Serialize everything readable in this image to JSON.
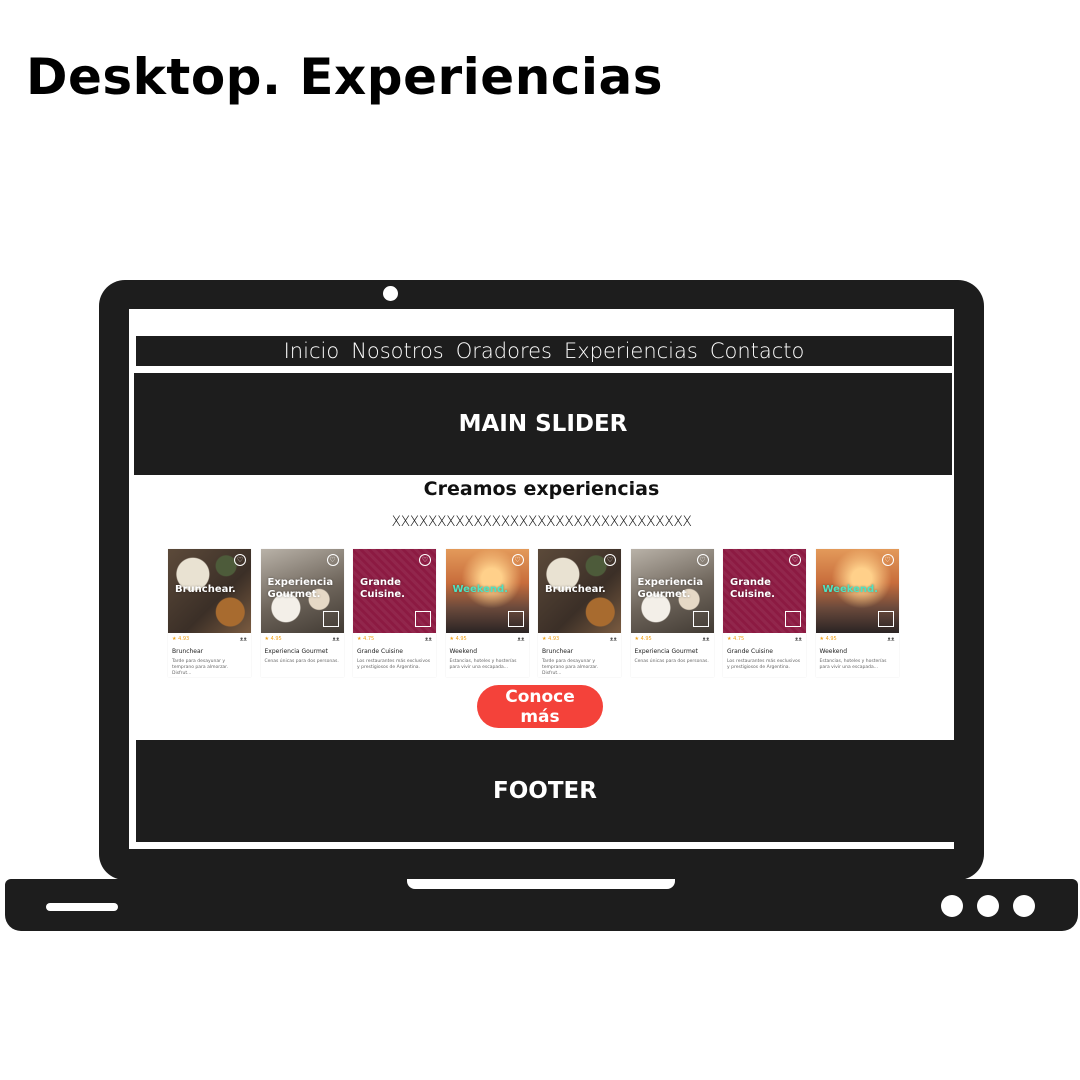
{
  "page_title": "Desktop. Experiencias",
  "nav": {
    "items": [
      "Inicio",
      "Nosotros",
      "Oradores",
      "Experiencias",
      "Contacto"
    ]
  },
  "slider": {
    "label": "MAIN SLIDER"
  },
  "section": {
    "title": "Creamos experiencias",
    "subtitle": "XXXXXXXXXXXXXXXXXXXXXXXXXXXXXXXXX"
  },
  "cards": [
    {
      "image_text": "Brunchear.",
      "rating": "★ 4.93",
      "name": "Brunchear",
      "description": "Tarde para desayunar y temprano para almorzar. Disfrut...",
      "image": "food"
    },
    {
      "image_text": "Experiencia Gourmet.",
      "rating": "★ 4.95",
      "name": "Experiencia Gourmet",
      "description": "Cenas únicas para dos personas.",
      "image": "gourmet"
    },
    {
      "image_text": "Grande Cuisine.",
      "rating": "★ 4.75",
      "name": "Grande Cuisine",
      "description": "Los restaurantes más exclusivos y prestigiosos de Argentina.",
      "image": "cuisine"
    },
    {
      "image_text": "Weekend.",
      "rating": "★ 4.95",
      "name": "Weekend",
      "description": "Estancias, hoteles y hosterías para vivir una escapada...",
      "image": "weekend"
    },
    {
      "image_text": "Brunchear.",
      "rating": "★ 4.93",
      "name": "Brunchear",
      "description": "Tarde para desayunar y temprano para almorzar. Disfrut...",
      "image": "food"
    },
    {
      "image_text": "Experiencia Gourmet.",
      "rating": "★ 4.95",
      "name": "Experiencia Gourmet",
      "description": "Cenas únicas para dos personas.",
      "image": "gourmet"
    },
    {
      "image_text": "Grande Cuisine.",
      "rating": "★ 4.75",
      "name": "Grande Cuisine",
      "description": "Los restaurantes más exclusivos y prestigiosos de Argentina.",
      "image": "cuisine"
    },
    {
      "image_text": "Weekend.",
      "rating": "★ 4.95",
      "name": "Weekend",
      "description": "Estancias, hoteles y hosterías para vivir una escapada...",
      "image": "weekend"
    }
  ],
  "cta": {
    "label": "Conoce más",
    "color": "#f4423a"
  },
  "footer": {
    "label": "FOOTER"
  },
  "icons": {
    "heart": "heart-icon",
    "rating": "star-icon",
    "people": "people-icon",
    "logo": "bigbox-logo"
  },
  "colors": {
    "frame": "#1d1d1d",
    "accent": "#f4423a",
    "cuisine": "#8c1a42",
    "weekend_text": "#4ee3c3"
  }
}
